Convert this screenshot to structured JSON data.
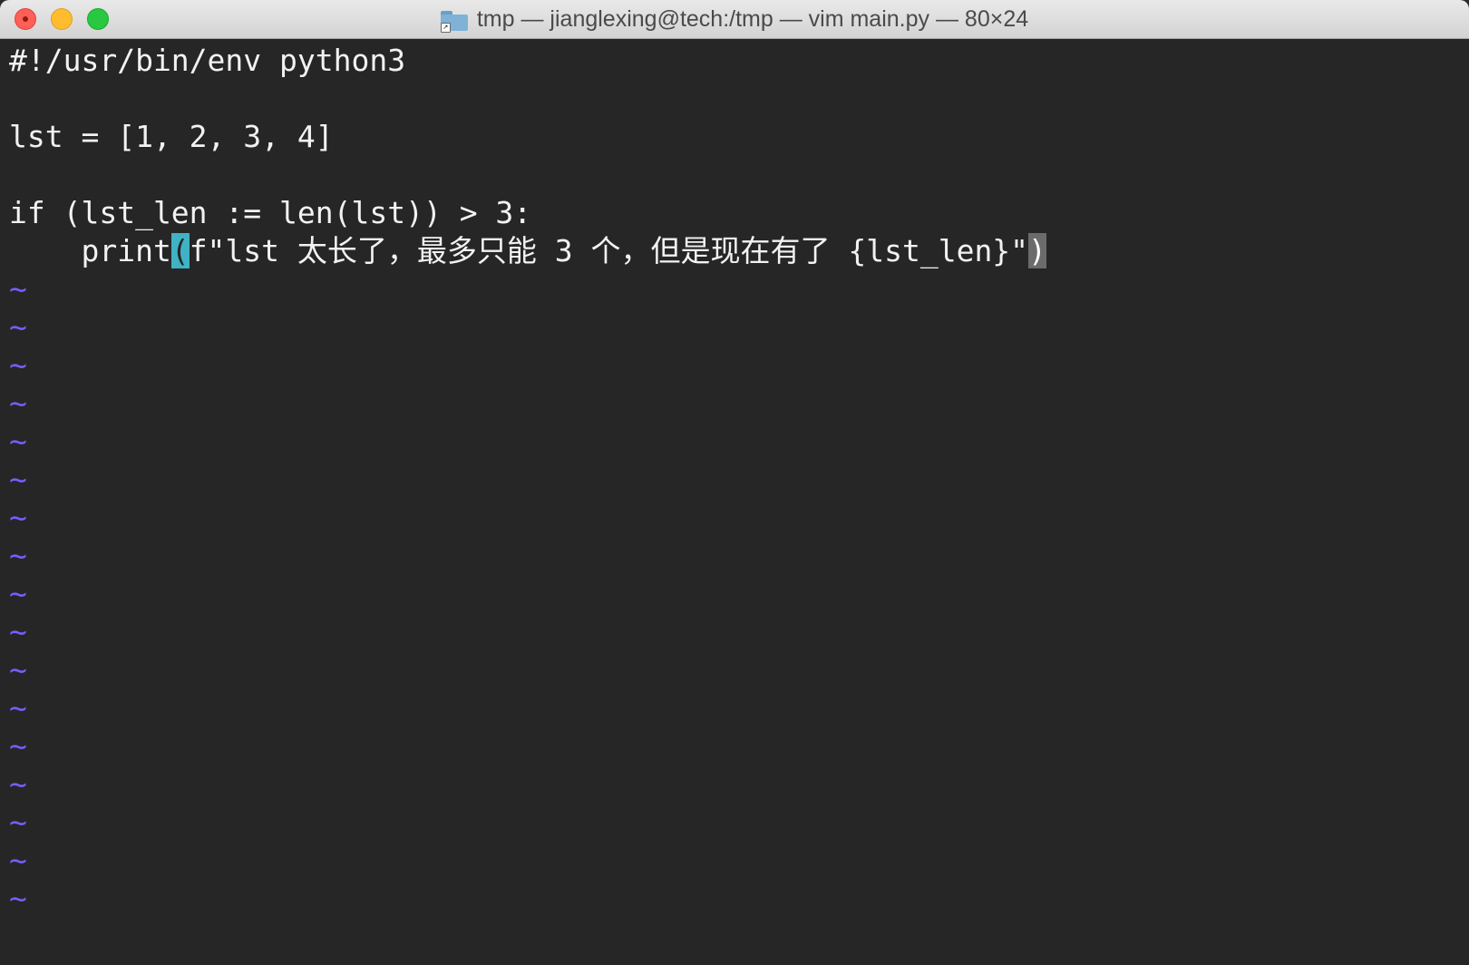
{
  "window": {
    "title": "tmp — jianglexing@tech:/tmp — vim main.py — 80×24"
  },
  "editor": {
    "lines": {
      "l1": "#!/usr/bin/env python3",
      "l2": "",
      "l3": "lst = [1, 2, 3, 4]",
      "l4": "",
      "l5": "if (lst_len := len(lst)) > 3:",
      "l6_prefix": "    print",
      "l6_cursor": "(",
      "l6_middle": "f\"lst 太长了，最多只能 3 个，但是现在有了 {lst_len}\"",
      "l6_match": ")"
    },
    "empty_line_marker": "~",
    "colors": {
      "background": "#262626",
      "text": "#f2f2f2",
      "tilde": "#7a5cff",
      "cursor": "#3fb3c5",
      "matching_paren": "#6b6b6b"
    }
  }
}
